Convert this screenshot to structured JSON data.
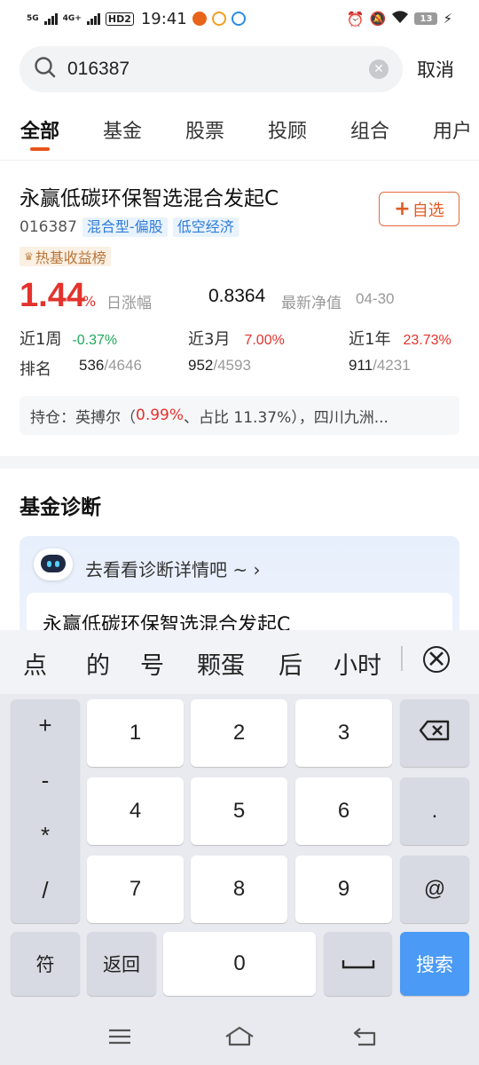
{
  "status": {
    "net1": "5G",
    "net2": "4G+",
    "hd": "HD2",
    "time": "19:41",
    "battery": "13"
  },
  "search": {
    "value": "016387",
    "cancel_label": "取消"
  },
  "tabs": [
    "全部",
    "基金",
    "股票",
    "投顾",
    "组合",
    "用户"
  ],
  "fund": {
    "name": "永赢低碳环保智选混合发起C",
    "code": "016387",
    "tags": [
      "混合型-偏股",
      "低空经济"
    ],
    "hot_tag": "热基收益榜",
    "add_label": "自选",
    "day_change": "1.44",
    "day_change_unit": "%",
    "day_change_label": "日涨幅",
    "nav": "0.8364",
    "nav_label": "最新净值",
    "nav_date": "04-30",
    "perf": [
      {
        "label": "近1周",
        "value": "-0.37%",
        "color": "#1ea85a"
      },
      {
        "label": "近3月",
        "value": "7.00%",
        "color": "#e4322c"
      },
      {
        "label": "近1年",
        "value": "23.73%",
        "color": "#e4322c"
      }
    ],
    "rank_label": "排名",
    "ranks": [
      {
        "pos": "536",
        "total": "/4646"
      },
      {
        "pos": "952",
        "total": "/4593"
      },
      {
        "pos": "911",
        "total": "/4231"
      }
    ],
    "holdings": {
      "prefix": "持仓：英搏尔（",
      "pct": "0.99%",
      "suffix": "、占比 11.37%），四川九洲..."
    }
  },
  "diagnosis": {
    "title": "基金诊断",
    "link": "去看看诊断详情吧 ~ ›",
    "fund_name": "永赢低碳环保智选混合发起C"
  },
  "keyboard": {
    "candidates": [
      "点",
      "的",
      "号",
      "颗蛋",
      "后",
      "小时"
    ],
    "symbols": [
      "+",
      "-",
      "*",
      "/"
    ],
    "digits": [
      "1",
      "2",
      "3",
      "4",
      "5",
      "6",
      "7",
      "8",
      "9",
      "0"
    ],
    "dot": ".",
    "at": "@",
    "sym_label": "符",
    "back_label": "返回",
    "search_label": "搜索"
  }
}
